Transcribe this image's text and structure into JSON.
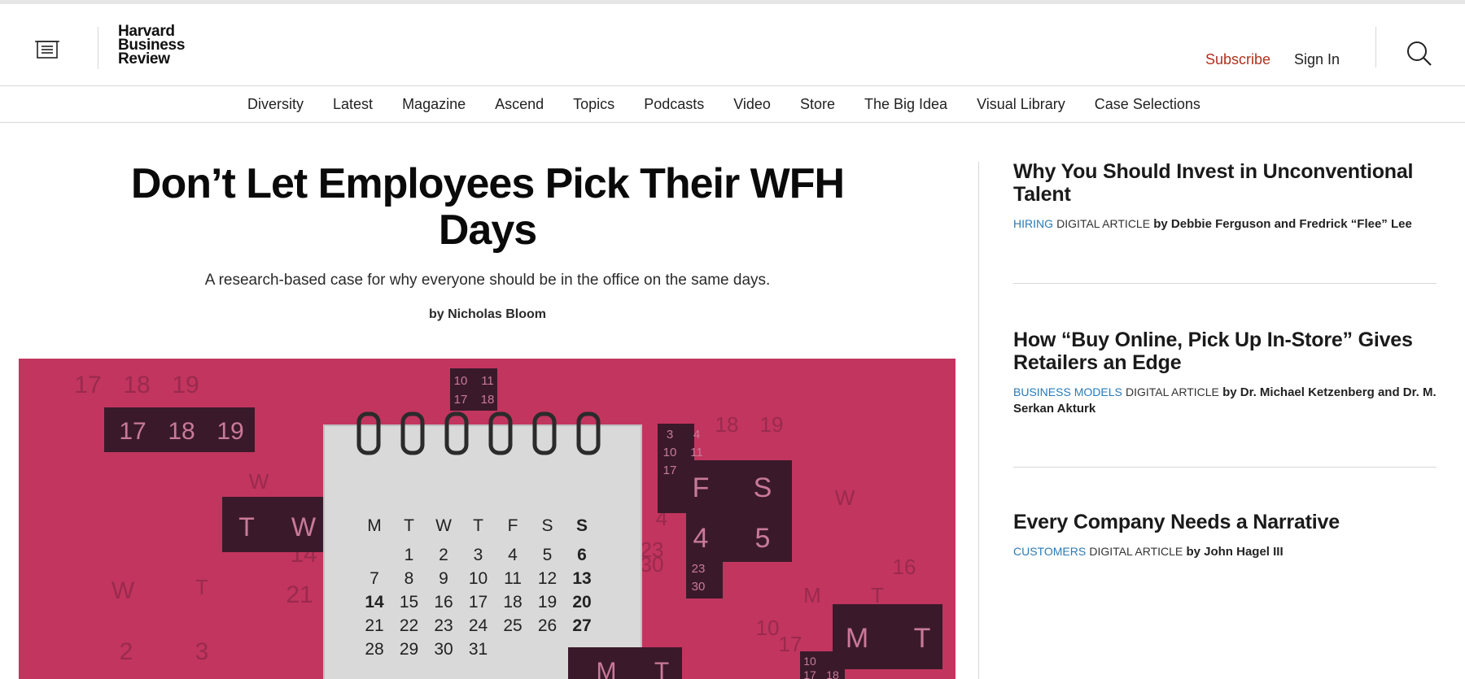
{
  "header": {
    "logo_lines": [
      "Harvard",
      "Business",
      "Review"
    ],
    "subscribe_label": "Subscribe",
    "signin_label": "Sign In",
    "menu_icon": "menu-icon",
    "search_icon": "search-icon",
    "accent_color": "#b0311f"
  },
  "nav": {
    "items": [
      "Diversity",
      "Latest",
      "Magazine",
      "Ascend",
      "Topics",
      "Podcasts",
      "Video",
      "Store",
      "The Big Idea",
      "Visual Library",
      "Case Selections"
    ]
  },
  "article": {
    "title": "Don’t Let Employees Pick Their WFH Days",
    "dek": "A research-based case for why everyone should be in the office on the same days.",
    "byline": "by Nicholas Bloom",
    "hero_color": "#c2355f",
    "calendar": {
      "weekdays": [
        "M",
        "T",
        "W",
        "T",
        "F",
        "S",
        "S"
      ],
      "rows": [
        [
          "",
          "1",
          "2",
          "3",
          "4",
          "5",
          "6"
        ],
        [
          "7",
          "8",
          "9",
          "10",
          "11",
          "12",
          "13"
        ],
        [
          "14",
          "15",
          "16",
          "17",
          "18",
          "19",
          "20"
        ],
        [
          "21",
          "22",
          "23",
          "24",
          "25",
          "26",
          "27"
        ],
        [
          "28",
          "29",
          "30",
          "31",
          "",
          "",
          ""
        ]
      ]
    },
    "hero_tiles": {
      "tile_a": [
        "17",
        "18",
        "19"
      ],
      "tile_b": [
        "10",
        "11",
        "17",
        "18"
      ],
      "tile_c": [
        "T",
        "W"
      ],
      "tile_d": [
        "3",
        "4",
        "10",
        "11",
        "17"
      ],
      "tile_e": [
        "F",
        "S",
        "4",
        "5"
      ],
      "tile_f": [
        "23",
        "30"
      ],
      "tile_g": [
        "M",
        "T"
      ],
      "tile_h": [
        "10",
        "17",
        "18"
      ],
      "bg_nums": [
        "17",
        "18",
        "19",
        "14",
        "21",
        "2",
        "3",
        "W",
        "T",
        "W",
        "T",
        "W",
        "M",
        "T",
        "18",
        "19",
        "4",
        "23",
        "30",
        "16",
        "10",
        "17"
      ]
    }
  },
  "sidebar": {
    "items": [
      {
        "title": "Why You Should Invest in Unconventional Talent",
        "topic": "Hiring",
        "kind": "Digital Article",
        "authors": "by Debbie Ferguson and Fredrick “Flee” Lee"
      },
      {
        "title": "How “Buy Online, Pick Up In-Store” Gives Retailers an Edge",
        "topic": "Business Models",
        "kind": "Digital Article",
        "authors": "by Dr. Michael Ketzenberg and Dr. M. Serkan Akturk"
      },
      {
        "title": "Every Company Needs a Narrative",
        "topic": "Customers",
        "kind": "Digital Article",
        "authors": "by John Hagel III"
      }
    ]
  }
}
